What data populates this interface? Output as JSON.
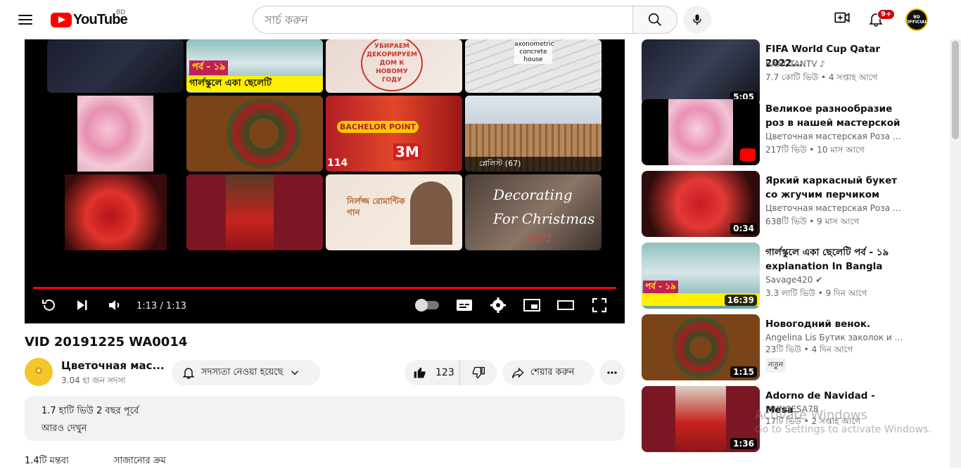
{
  "header": {
    "logo_text": "YouTube",
    "country_code": "BD",
    "search_placeholder": "সার্চ করুন",
    "notifications_count": "9+",
    "account_label": "BD OFFICIAL"
  },
  "player": {
    "time": "1:13 / 1:13",
    "progress": 1.0,
    "tiles": [
      {
        "text": "পর্ব - ১৯",
        "sub": "গার্লস্কুলে একা ছেলেটি"
      },
      {
        "text": "УБИРАЕМ ДЕКОРИРУЕМ ДОМ К НОВОМУ ГОДУ"
      },
      {
        "text": "axonometric concrete house"
      },
      {
        "text": "BACHELOR POINT"
      },
      {
        "text": "3M"
      },
      {
        "text": "114"
      },
      {
        "text": "প্লেলিস্ট (67)"
      },
      {
        "text": "নির্লজ্জ রোমান্টিক গান"
      },
      {
        "text": "Decorating For Christmas"
      },
      {
        "text": "2022"
      }
    ]
  },
  "video": {
    "title": "VID 20191225 WA0014",
    "channel_name": "Цветочная мас...",
    "channel_subs": "3.04 হা জন সদস্য",
    "subscribe_label": "সদস্যতা নেওয়া হয়েছে",
    "like_count": "123",
    "share_label": "শেয়ার করুন",
    "views": "1.7 হাটি ভিউ  2 বছর পূর্বে",
    "more_label": "আরও দেখুন"
  },
  "sidebar": {
    "items": [
      {
        "title": "FIFA World Cup Qatar 2022...",
        "channel": "BANGTANTV ♪",
        "meta": "7.7 কোটি ভিউ • 4 সপ্তাহ আগে",
        "duration": "5:05"
      },
      {
        "title": "Великое разнообразие роз в нашей мастерской",
        "channel": "Цветочная мастерская Роза Ветр...",
        "meta": "217টি ভিউ • 10 মাস আগে",
        "duration": ""
      },
      {
        "title": "Яркий каркасный букет со жгучим перчиком",
        "channel": "Цветочная мастерская Роза Ветр...",
        "meta": "638টি ভিউ • 9 মাস আগে",
        "duration": "0:34"
      },
      {
        "title": "গার্লস্কুলে একা ছেলেটি পর্ব - ১৯ explanation In Bangla Movie...",
        "channel": "Savage420 ✔",
        "meta": "3.3 লাটি ভিউ • 9 দিন আগে",
        "duration": "16:39"
      },
      {
        "title": "Новогодний венок.",
        "channel": "Angelina Lis Бутик заколок и рези...",
        "meta": "23টি ভিউ • 4 দিন আগে",
        "duration": "1:15",
        "badge": "নতুন"
      },
      {
        "title": "Adorno de Navidad - Mesa",
        "channel": "PRINCESA78",
        "meta": "17টি ভিউ • 2 সপ্তাহ আগে",
        "duration": "1:36"
      }
    ]
  },
  "overlay": {
    "activate_title": "Activate Windows",
    "activate_sub": "Go to Settings to activate Windows."
  },
  "bottom": {
    "comments": "1.4টি মন্তব্য",
    "sort": "সাজানোর ক্রম"
  }
}
